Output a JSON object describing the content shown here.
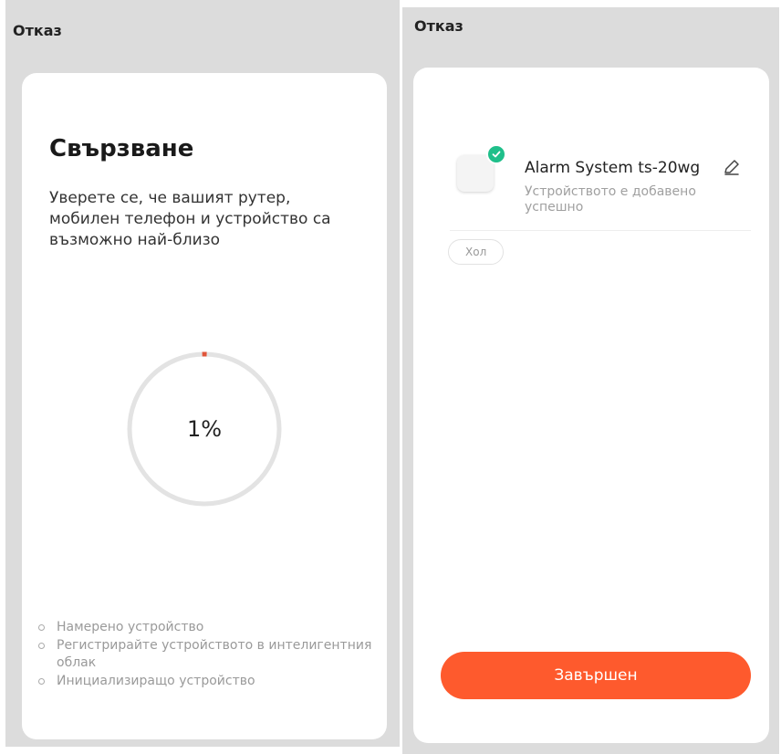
{
  "left_screen": {
    "cancel_label": "Отказ",
    "title": "Свързване",
    "description": "Уверете се, че вашият рутер, мобилен телефон и устройство са възможно най-близо",
    "progress": {
      "value": 1,
      "label": "1%"
    },
    "steps": [
      "Намерено устройство",
      "Регистрирайте устройството в интелигентния облак",
      "Инициализиращо устройство"
    ]
  },
  "right_screen": {
    "cancel_label": "Отказ",
    "device": {
      "name": "Alarm System ts-20wg",
      "status": "Устройството е добавено успешно",
      "icon": "edit-pencil-icon"
    },
    "room_chip": "Хол",
    "finish_label": "Завършен"
  },
  "colors": {
    "panel_background": "#dcdcdc",
    "card_background": "#ffffff",
    "accent": "#fe5a2d",
    "progress_track": "#e3e3e3",
    "progress_indicator": "#e0553a",
    "success": "#1fbf8a"
  }
}
